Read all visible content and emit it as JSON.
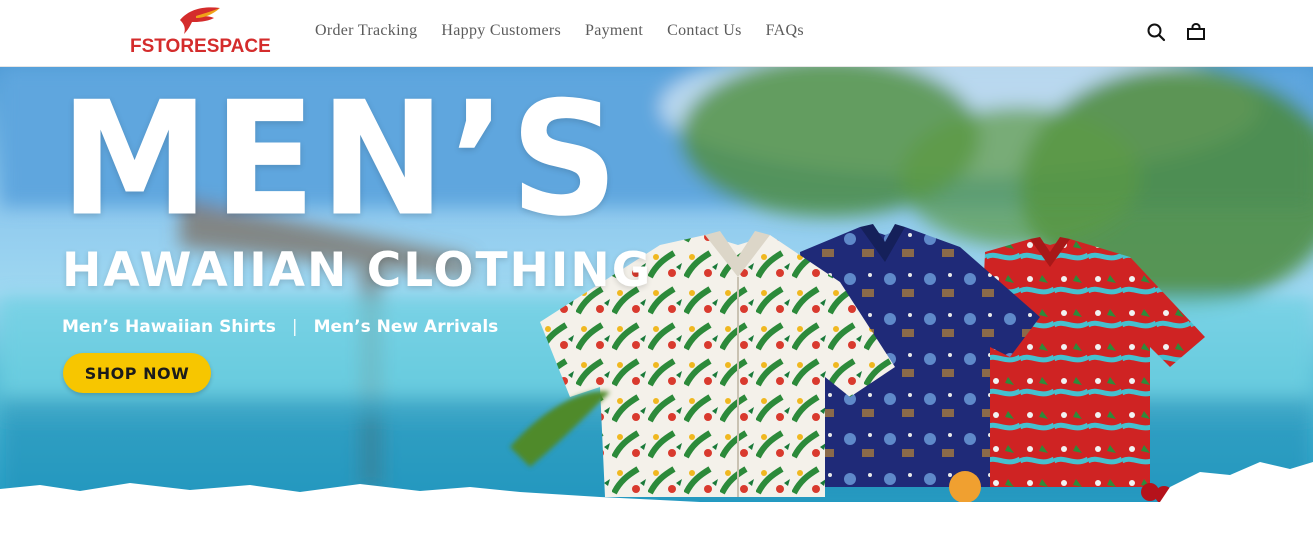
{
  "brand": {
    "name": "FSTORESPACE",
    "color": "#d42c2c"
  },
  "nav": {
    "items": [
      {
        "label": "Order Tracking"
      },
      {
        "label": "Happy Customers"
      },
      {
        "label": "Payment"
      },
      {
        "label": "Contact Us"
      },
      {
        "label": "FAQs"
      }
    ]
  },
  "header_icons": {
    "search": "search-icon",
    "cart": "shopping-bag-icon"
  },
  "hero": {
    "title": "MEN’S",
    "subtitle": "HAWAIIAN CLOTHING",
    "links": [
      "Men’s Hawaiian Shirts",
      "Men’s New Arrivals"
    ],
    "separator": "|",
    "cta_label": "SHOP NOW",
    "cta_color": "#f7c600"
  }
}
